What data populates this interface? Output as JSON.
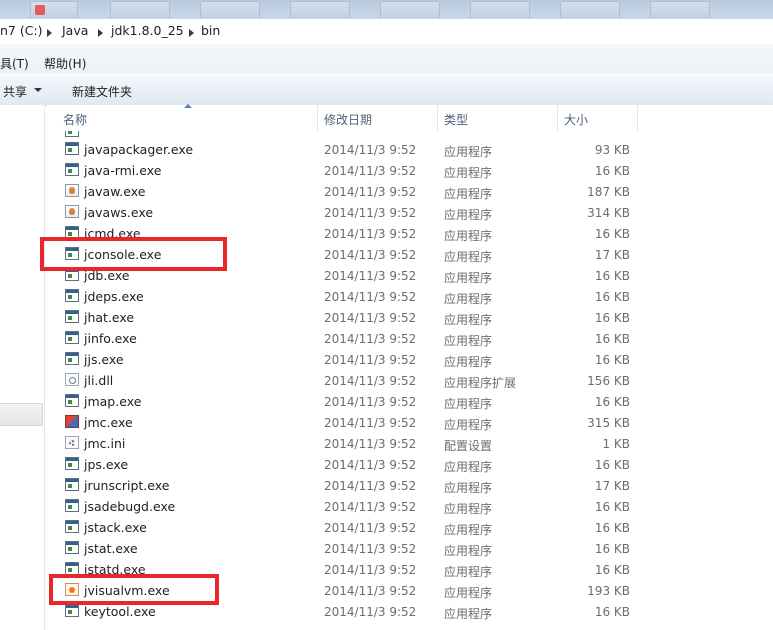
{
  "address": {
    "crumbs": [
      "n7 (C:)",
      "Java",
      "jdk1.8.0_25",
      "bin"
    ]
  },
  "menu": {
    "items": [
      "具(T)",
      "帮助(H)"
    ]
  },
  "toolbar": {
    "share_label": "共享",
    "new_folder_label": "新建文件夹"
  },
  "columns": {
    "name": "名称",
    "date": "修改日期",
    "type": "类型",
    "size": "大小"
  },
  "files": [
    {
      "name": "javapackager.exe",
      "date": "2014/11/3 9:52",
      "type": "应用程序",
      "size": "93 KB",
      "icon": "exe-icon"
    },
    {
      "name": "java-rmi.exe",
      "date": "2014/11/3 9:52",
      "type": "应用程序",
      "size": "16 KB",
      "icon": "exe-icon"
    },
    {
      "name": "javaw.exe",
      "date": "2014/11/3 9:52",
      "type": "应用程序",
      "size": "187 KB",
      "icon": "java-icon"
    },
    {
      "name": "javaws.exe",
      "date": "2014/11/3 9:52",
      "type": "应用程序",
      "size": "314 KB",
      "icon": "java-icon"
    },
    {
      "name": "jcmd.exe",
      "date": "2014/11/3 9:52",
      "type": "应用程序",
      "size": "16 KB",
      "icon": "exe-icon"
    },
    {
      "name": "jconsole.exe",
      "date": "2014/11/3 9:52",
      "type": "应用程序",
      "size": "17 KB",
      "icon": "exe-icon"
    },
    {
      "name": "jdb.exe",
      "date": "2014/11/3 9:52",
      "type": "应用程序",
      "size": "16 KB",
      "icon": "exe-icon"
    },
    {
      "name": "jdeps.exe",
      "date": "2014/11/3 9:52",
      "type": "应用程序",
      "size": "16 KB",
      "icon": "exe-icon"
    },
    {
      "name": "jhat.exe",
      "date": "2014/11/3 9:52",
      "type": "应用程序",
      "size": "16 KB",
      "icon": "exe-icon"
    },
    {
      "name": "jinfo.exe",
      "date": "2014/11/3 9:52",
      "type": "应用程序",
      "size": "16 KB",
      "icon": "exe-icon"
    },
    {
      "name": "jjs.exe",
      "date": "2014/11/3 9:52",
      "type": "应用程序",
      "size": "16 KB",
      "icon": "exe-icon"
    },
    {
      "name": "jli.dll",
      "date": "2014/11/3 9:52",
      "type": "应用程序扩展",
      "size": "156 KB",
      "icon": "dll-icon"
    },
    {
      "name": "jmap.exe",
      "date": "2014/11/3 9:52",
      "type": "应用程序",
      "size": "16 KB",
      "icon": "exe-icon"
    },
    {
      "name": "jmc.exe",
      "date": "2014/11/3 9:52",
      "type": "应用程序",
      "size": "315 KB",
      "icon": "jmc-icon"
    },
    {
      "name": "jmc.ini",
      "date": "2014/11/3 9:52",
      "type": "配置设置",
      "size": "1 KB",
      "icon": "ini-icon"
    },
    {
      "name": "jps.exe",
      "date": "2014/11/3 9:52",
      "type": "应用程序",
      "size": "16 KB",
      "icon": "exe-icon"
    },
    {
      "name": "jrunscript.exe",
      "date": "2014/11/3 9:52",
      "type": "应用程序",
      "size": "17 KB",
      "icon": "exe-icon"
    },
    {
      "name": "jsadebugd.exe",
      "date": "2014/11/3 9:52",
      "type": "应用程序",
      "size": "16 KB",
      "icon": "exe-icon"
    },
    {
      "name": "jstack.exe",
      "date": "2014/11/3 9:52",
      "type": "应用程序",
      "size": "16 KB",
      "icon": "exe-icon"
    },
    {
      "name": "jstat.exe",
      "date": "2014/11/3 9:52",
      "type": "应用程序",
      "size": "16 KB",
      "icon": "exe-icon"
    },
    {
      "name": "jstatd.exe",
      "date": "2014/11/3 9:52",
      "type": "应用程序",
      "size": "16 KB",
      "icon": "exe-icon"
    },
    {
      "name": "jvisualvm.exe",
      "date": "2014/11/3 9:52",
      "type": "应用程序",
      "size": "193 KB",
      "icon": "visualvm-icon"
    },
    {
      "name": "keytool.exe",
      "date": "2014/11/3 9:52",
      "type": "应用程序",
      "size": "16 KB",
      "icon": "exe-icon"
    }
  ],
  "highlighted_files": [
    "jconsole.exe",
    "jvisualvm.exe"
  ],
  "colors": {
    "highlight": "#e8262c",
    "header_text": "#4c607a",
    "detail_text": "#6d6d6d"
  }
}
